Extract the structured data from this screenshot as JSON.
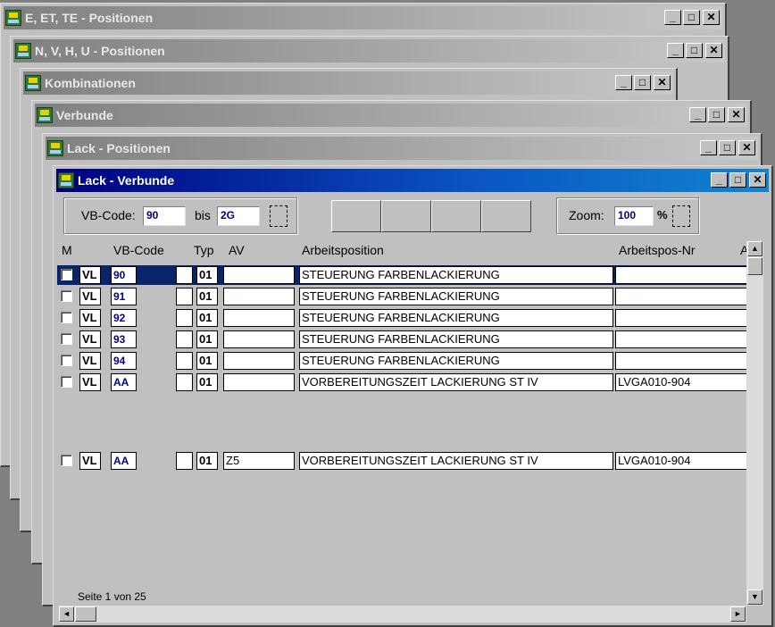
{
  "background_windows": [
    {
      "title": "E, ET, TE - Positionen"
    },
    {
      "title": "N, V, H, U - Positionen"
    },
    {
      "title": "Kombinationen"
    },
    {
      "title": "Verbunde"
    },
    {
      "title": "Lack - Positionen"
    }
  ],
  "window_buttons": {
    "minimize": "_",
    "maximize": "□",
    "close": "✕"
  },
  "main_window": {
    "title": "Lack - Verbunde",
    "filter": {
      "vb_code_label": "VB-Code:",
      "from_value": "90",
      "bis_label": "bis",
      "to_value": "2G"
    },
    "zoom": {
      "label": "Zoom:",
      "value": "100",
      "unit": "%"
    },
    "columns": {
      "m": "M",
      "vb_code": "VB-Code",
      "typ": "Typ",
      "av": "AV",
      "arbeitsposition": "Arbeitsposition",
      "arbeitspos_nr": "Arbeitspos-Nr",
      "extra": "A"
    },
    "rows": [
      {
        "prefix": "VL",
        "code": "90",
        "typ": "01",
        "av": "",
        "arbeitsposition": "STEUERUNG FARBENLACKIERUNG",
        "nr": "",
        "selected": true
      },
      {
        "prefix": "VL",
        "code": "91",
        "typ": "01",
        "av": "",
        "arbeitsposition": "STEUERUNG FARBENLACKIERUNG",
        "nr": "",
        "selected": false
      },
      {
        "prefix": "VL",
        "code": "92",
        "typ": "01",
        "av": "",
        "arbeitsposition": "STEUERUNG FARBENLACKIERUNG",
        "nr": "",
        "selected": false
      },
      {
        "prefix": "VL",
        "code": "93",
        "typ": "01",
        "av": "",
        "arbeitsposition": "STEUERUNG FARBENLACKIERUNG",
        "nr": "",
        "selected": false
      },
      {
        "prefix": "VL",
        "code": "94",
        "typ": "01",
        "av": "",
        "arbeitsposition": "STEUERUNG FARBENLACKIERUNG",
        "nr": "",
        "selected": false
      },
      {
        "prefix": "VL",
        "code": "AA",
        "typ": "01",
        "av": "",
        "arbeitsposition": "VORBEREITUNGSZEIT LACKIERUNG ST IV",
        "nr": "LVGA010-904",
        "selected": false
      },
      {
        "prefix": "VL",
        "code": "AA",
        "typ": "01",
        "av": "Z5",
        "arbeitsposition": "VORBEREITUNGSZEIT LACKIERUNG ST IV",
        "nr": "LVGA010-904",
        "selected": false
      }
    ],
    "status": "Seite 1 von 25",
    "scroll": {
      "up": "▲",
      "down": "▼",
      "left": "◄",
      "right": "►"
    }
  },
  "colors": {
    "selection": "#0a246a",
    "active_title": "#000080",
    "code_text": "#000080"
  }
}
